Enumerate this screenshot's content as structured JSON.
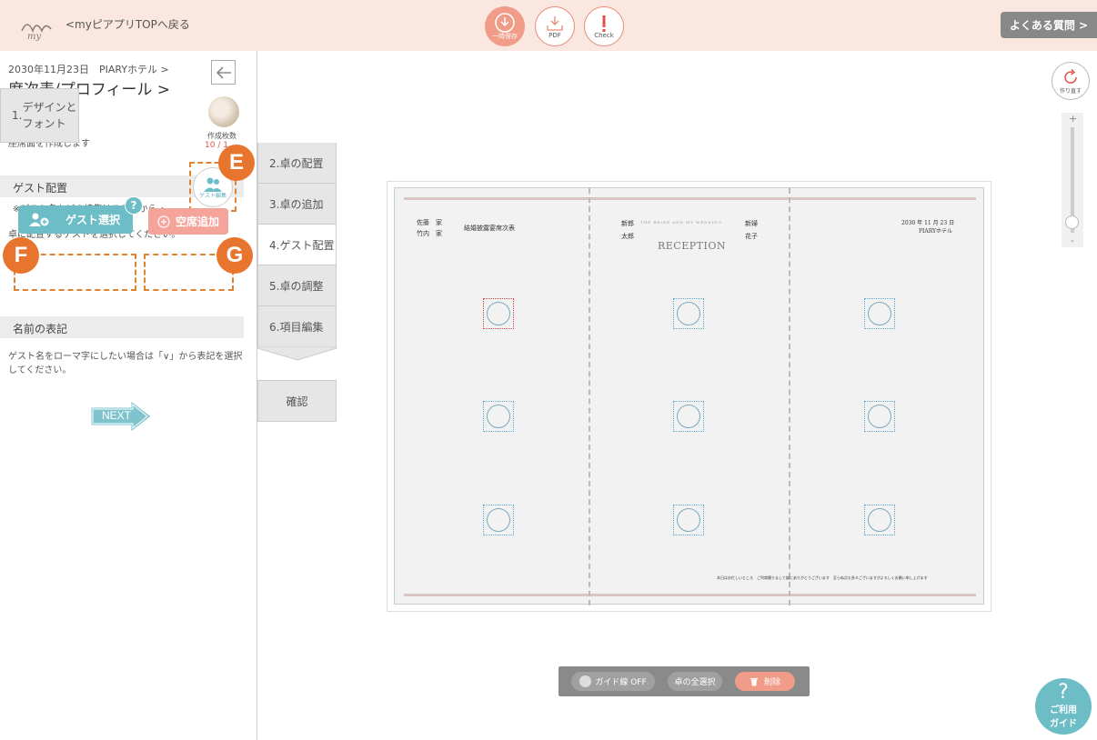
{
  "header": {
    "logo_text": "my",
    "back_link": "<myピアプリTOPへ戻る",
    "save_label": "一時保存",
    "pdf_label": "PDF",
    "check_label": "Check",
    "faq_label": "よくある質問 >"
  },
  "sidebar": {
    "breadcrumb": "2030年11月23日　PIARYホテル >",
    "title_line1": "席次表/プロフィール >",
    "title_line2": "座席面",
    "description": "座席面を作成します",
    "count_label": "作成枚数",
    "count_value": "10 / 1",
    "guest_section": "ゲスト配置",
    "guest_note": "※ゲスト名などの編集はこちらから→",
    "guest_edit_label": "ゲスト編集",
    "guest_instruction": "卓に配置するゲストを選択してください。",
    "guest_select_label": "ゲスト選択",
    "empty_seat_label": "空席追加",
    "help_label": "?",
    "name_section": "名前の表記",
    "name_note": "ゲスト名をローマ字にしたい場合は「∨」から表記を選択してください。",
    "next_label": "NEXT"
  },
  "annotations": {
    "e": "E",
    "f": "F",
    "g": "G"
  },
  "steps": [
    {
      "num": "1.",
      "label": "デザインと\nフォント"
    },
    {
      "label": "2.卓の配置"
    },
    {
      "label": "3.卓の追加"
    },
    {
      "label": "4.ゲスト配置"
    },
    {
      "label": "5.卓の調整"
    },
    {
      "label": "6.項目編集"
    }
  ],
  "confirm_label": "確認",
  "canvas": {
    "families_left_1": "佐藤　家",
    "families_left_2": "竹内　家",
    "reception_title": "結婚披露宴席次表",
    "groom_label": "新郎",
    "groom_name": "太郎",
    "bride_label": "新婦",
    "bride_name": "花子",
    "arc_text": "THE BRIDE AND MY WEDDING",
    "reception": "RECEPTION",
    "date": "2030 年 11 月 23 日",
    "venue": "PIARYホテル",
    "footer": "本日はお忙しいところ　ご列席賜りまして誠にありがとうございます　至らぬ点も多々ございますがよろしくお願い申し上げます"
  },
  "redo_label": "作り直す",
  "zoom": {
    "plus": "+",
    "minus": "-"
  },
  "bottom_tools": {
    "guide_label": "ガイド線 OFF",
    "select_all_label": "卓の全選択",
    "delete_label": "削除"
  },
  "help_guide": {
    "q": "?",
    "line1": "ご利用",
    "line2": "ガイド"
  },
  "colors": {
    "header_bg": "#fae7e0",
    "accent_teal": "#6cbdc6",
    "accent_coral": "#f4a49a",
    "annotation_orange": "#e8752d"
  }
}
